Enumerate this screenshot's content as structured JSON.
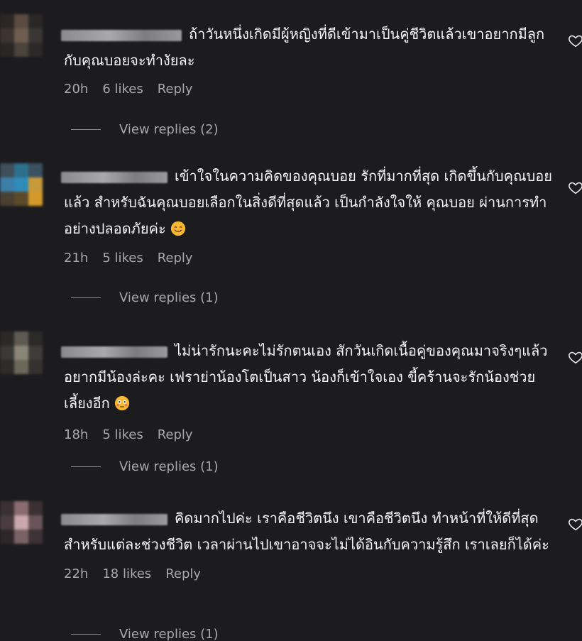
{
  "comments": [
    {
      "text": "ถ้าวันหนึ่งเกิดมีผู้หญิงที่ดีเข้ามาเป็นคู่ชีวิตแล้วเขาอยากมีลูกกับคุณบอยจะทำงัยละ",
      "time": "20h",
      "likes": "6 likes",
      "reply_label": "Reply",
      "view_replies": "View replies (2)",
      "avatar_colors": [
        "#2b2624",
        "#5a4a40",
        "#2a2827",
        "#3d3431",
        "#6e5c50",
        "#3a3634",
        "#2a2625",
        "#4b433d",
        "#2b2928"
      ]
    },
    {
      "text": "เข้าใจในความคิดของคุณบอย รักที่มากที่สุด เกิดขึ้นกับคุณบอยแล้ว สำหรับฉันคุณบอยเลือกในสิ่งดีที่สุดแล้ว เป็นกำลังใจให้ คุณบอย ผ่านการทำ อย่างปลอดภัยค่ะ",
      "time": "21h",
      "likes": "5 likes",
      "reply_label": "Reply",
      "view_replies": "View replies (1)",
      "avatar_colors": [
        "#3e4e5a",
        "#2e6f8c",
        "#3a5160",
        "#3b7ea8",
        "#2f8bb8",
        "#c99a3a",
        "#4a4032",
        "#5b4a2a",
        "#d39a2a"
      ]
    },
    {
      "text": "ไม่น่ารักนะคะไม่รักตนเอง สักวันเกิดเนื้อคู่ของคุณมาจริงๆแล้วอยากมีน้องล่ะคะ เฟราย่าน้องโตเป็นสาว น้องก็เข้าใจเอง ขี้คร้านจะรักน้องช่วยเลี้ยงอีก",
      "time": "18h",
      "likes": "5 likes",
      "reply_label": "Reply",
      "view_replies": "View replies (1)",
      "avatar_colors": [
        "#2a2926",
        "#5e5a52",
        "#2b2a28",
        "#3a3935",
        "#8a8577",
        "#3e3c38",
        "#2d2c29",
        "#6b6759",
        "#33322f"
      ]
    },
    {
      "text": "คิดมากไปค่ะ เราคือชีวิตนึง เขาคือชีวิตนึง ทำหน้าที่ให้ดีที่สุดสำหรับแต่ละช่วงชีวิต เวลาผ่านไปเขาอาจจะไม่ได้อินกับความรู้สึก เราเลยก็ได้ค่ะ",
      "time": "22h",
      "likes": "18 likes",
      "reply_label": "Reply",
      "view_replies": "View replies (1)",
      "avatar_colors": [
        "#3a3033",
        "#8a6b72",
        "#3b3134",
        "#4a3c40",
        "#c9a8ae",
        "#6a5459",
        "#2e2729",
        "#7a6166",
        "#3c3336"
      ]
    }
  ],
  "icons": {
    "heart": "heart-icon",
    "smile_emoji": "smiling-face-emoji",
    "flushed_emoji": "flushed-face-emoji"
  },
  "colors": {
    "background": "#1c1c1f",
    "text": "#f5f5f5",
    "muted": "#a8a8ab"
  }
}
